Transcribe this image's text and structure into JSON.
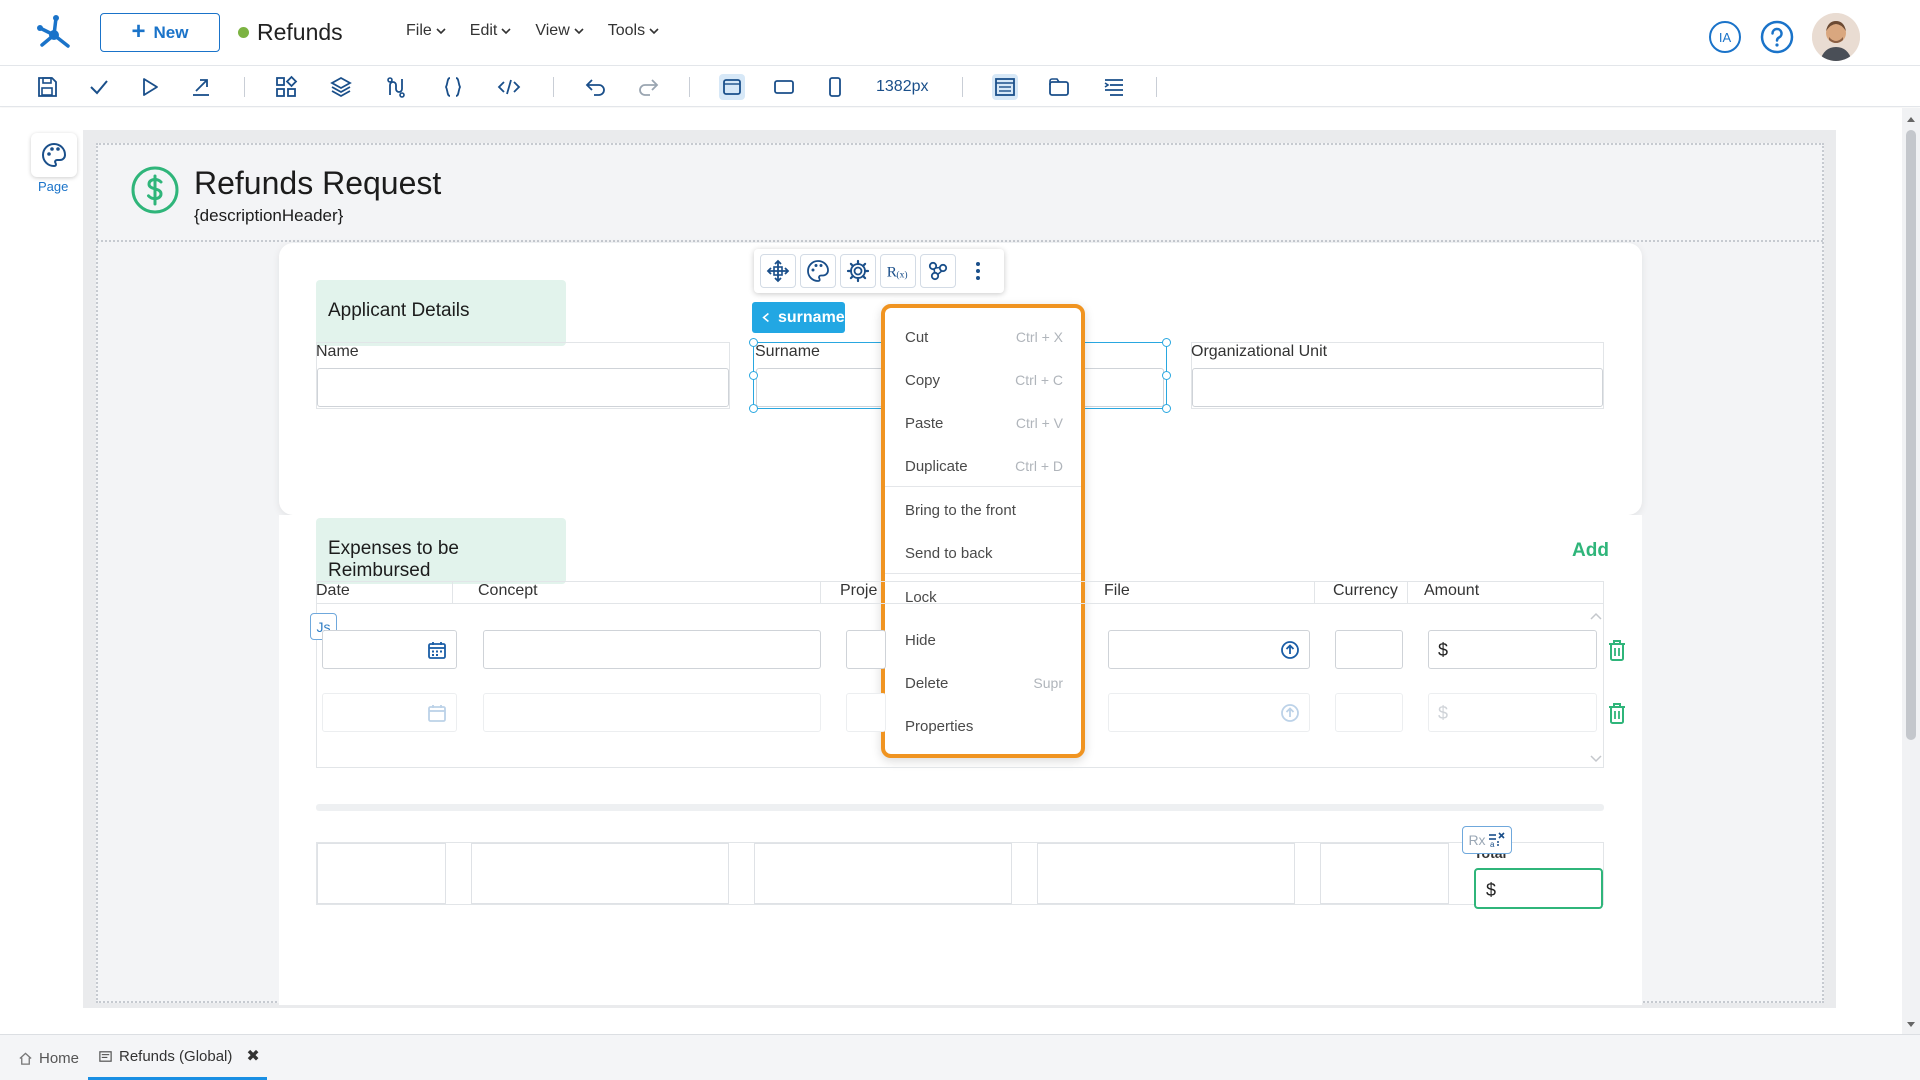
{
  "app": {
    "title": "Refunds",
    "new_button": "New",
    "status_color": "#7cb342"
  },
  "menu": [
    {
      "label": "File"
    },
    {
      "label": "Edit"
    },
    {
      "label": "View"
    },
    {
      "label": "Tools"
    }
  ],
  "header_icons": {
    "ia_label": "IA",
    "help": "help-icon",
    "avatar": "user-avatar"
  },
  "toolbar": {
    "width_label": "1382px",
    "icons": [
      "save-icon",
      "check-icon",
      "play-icon",
      "export-icon",
      "components-icon",
      "layers-icon",
      "variables-icon",
      "braces-icon",
      "code-icon",
      "undo-icon",
      "redo-icon",
      "desktop-view-icon",
      "tablet-view-icon",
      "mobile-view-icon",
      "layout-icon",
      "window-icon",
      "align-icon"
    ]
  },
  "left_panel": {
    "page_label": "Page"
  },
  "page": {
    "title": "Refunds Request",
    "subtitle": "{descriptionHeader}"
  },
  "applicant": {
    "section_title": "Applicant Details",
    "fields": {
      "name": "Name",
      "surname": "Surname",
      "org_unit": "Organizational Unit"
    }
  },
  "selection": {
    "tag": "surname"
  },
  "context_menu": {
    "items": [
      {
        "label": "Cut",
        "shortcut": "Ctrl + X"
      },
      {
        "label": "Copy",
        "shortcut": "Ctrl + C"
      },
      {
        "label": "Paste",
        "shortcut": "Ctrl + V"
      },
      {
        "label": "Duplicate",
        "shortcut": "Ctrl + D"
      },
      {
        "label": "Bring to the front",
        "shortcut": ""
      },
      {
        "label": "Send to back",
        "shortcut": ""
      },
      {
        "label": "Lock",
        "shortcut": ""
      },
      {
        "label": "Hide",
        "shortcut": ""
      },
      {
        "label": "Delete",
        "shortcut": "Supr"
      },
      {
        "label": "Properties",
        "shortcut": ""
      }
    ]
  },
  "context_toolbar": {
    "rx_label": "R(x)"
  },
  "expenses": {
    "section_title": "Expenses to be Reimbursed",
    "add_label": "Add",
    "columns": [
      "Date",
      "Concept",
      "Proje",
      "File",
      "Currency",
      "Amount"
    ],
    "currency_symbol": "$",
    "js_label": "Js",
    "total_label": "Total",
    "rx_label": "Rx"
  },
  "tabs": [
    {
      "label": "Home"
    },
    {
      "label": "Refunds (Global)"
    }
  ]
}
